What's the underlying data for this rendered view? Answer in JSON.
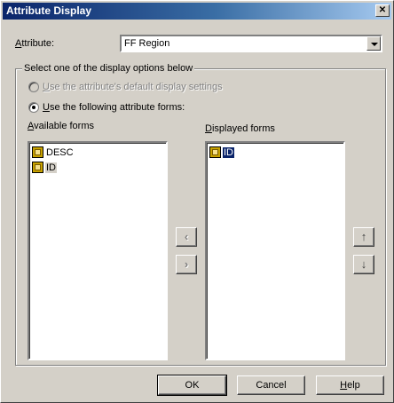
{
  "window": {
    "title": "Attribute Display",
    "close_glyph": "✕"
  },
  "attribute": {
    "label_accel": "A",
    "label_rest": "ttribute:",
    "value": "FF Region"
  },
  "group": {
    "legend": "Select one of the display options below",
    "option_default": {
      "accel": "U",
      "rest": "se the attribute's default display settings",
      "selected": false,
      "enabled": false
    },
    "option_forms": {
      "accel": "U",
      "rest": "se the following attribute forms:",
      "selected": true,
      "enabled": true
    }
  },
  "available": {
    "label_accel": "A",
    "label_rest": "vailable forms",
    "items": [
      {
        "label": "DESC",
        "icon": "attribute-form-icon"
      },
      {
        "label": "ID",
        "icon": "attribute-form-icon"
      }
    ]
  },
  "displayed": {
    "label_accel": "D",
    "label_rest": "isplayed forms",
    "items": [
      {
        "label": "ID",
        "icon": "attribute-form-icon"
      }
    ]
  },
  "move_buttons": {
    "left": "‹",
    "right": "›"
  },
  "order_buttons": {
    "up": "↑",
    "down": "↓"
  },
  "buttons": {
    "ok": "OK",
    "cancel": "Cancel",
    "help_accel": "H",
    "help_rest": "elp"
  }
}
